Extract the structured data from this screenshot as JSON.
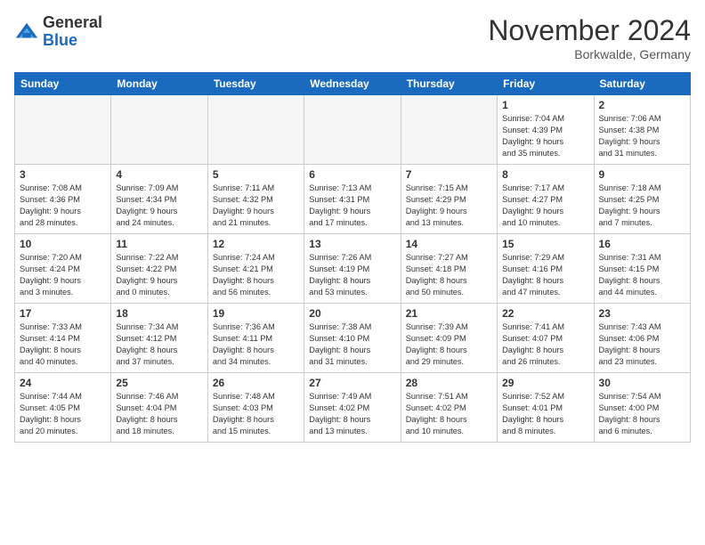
{
  "logo": {
    "general": "General",
    "blue": "Blue"
  },
  "header": {
    "title": "November 2024",
    "location": "Borkwalde, Germany"
  },
  "days_of_week": [
    "Sunday",
    "Monday",
    "Tuesday",
    "Wednesday",
    "Thursday",
    "Friday",
    "Saturday"
  ],
  "weeks": [
    [
      {
        "day": "",
        "info": ""
      },
      {
        "day": "",
        "info": ""
      },
      {
        "day": "",
        "info": ""
      },
      {
        "day": "",
        "info": ""
      },
      {
        "day": "",
        "info": ""
      },
      {
        "day": "1",
        "info": "Sunrise: 7:04 AM\nSunset: 4:39 PM\nDaylight: 9 hours\nand 35 minutes."
      },
      {
        "day": "2",
        "info": "Sunrise: 7:06 AM\nSunset: 4:38 PM\nDaylight: 9 hours\nand 31 minutes."
      }
    ],
    [
      {
        "day": "3",
        "info": "Sunrise: 7:08 AM\nSunset: 4:36 PM\nDaylight: 9 hours\nand 28 minutes."
      },
      {
        "day": "4",
        "info": "Sunrise: 7:09 AM\nSunset: 4:34 PM\nDaylight: 9 hours\nand 24 minutes."
      },
      {
        "day": "5",
        "info": "Sunrise: 7:11 AM\nSunset: 4:32 PM\nDaylight: 9 hours\nand 21 minutes."
      },
      {
        "day": "6",
        "info": "Sunrise: 7:13 AM\nSunset: 4:31 PM\nDaylight: 9 hours\nand 17 minutes."
      },
      {
        "day": "7",
        "info": "Sunrise: 7:15 AM\nSunset: 4:29 PM\nDaylight: 9 hours\nand 13 minutes."
      },
      {
        "day": "8",
        "info": "Sunrise: 7:17 AM\nSunset: 4:27 PM\nDaylight: 9 hours\nand 10 minutes."
      },
      {
        "day": "9",
        "info": "Sunrise: 7:18 AM\nSunset: 4:25 PM\nDaylight: 9 hours\nand 7 minutes."
      }
    ],
    [
      {
        "day": "10",
        "info": "Sunrise: 7:20 AM\nSunset: 4:24 PM\nDaylight: 9 hours\nand 3 minutes."
      },
      {
        "day": "11",
        "info": "Sunrise: 7:22 AM\nSunset: 4:22 PM\nDaylight: 9 hours\nand 0 minutes."
      },
      {
        "day": "12",
        "info": "Sunrise: 7:24 AM\nSunset: 4:21 PM\nDaylight: 8 hours\nand 56 minutes."
      },
      {
        "day": "13",
        "info": "Sunrise: 7:26 AM\nSunset: 4:19 PM\nDaylight: 8 hours\nand 53 minutes."
      },
      {
        "day": "14",
        "info": "Sunrise: 7:27 AM\nSunset: 4:18 PM\nDaylight: 8 hours\nand 50 minutes."
      },
      {
        "day": "15",
        "info": "Sunrise: 7:29 AM\nSunset: 4:16 PM\nDaylight: 8 hours\nand 47 minutes."
      },
      {
        "day": "16",
        "info": "Sunrise: 7:31 AM\nSunset: 4:15 PM\nDaylight: 8 hours\nand 44 minutes."
      }
    ],
    [
      {
        "day": "17",
        "info": "Sunrise: 7:33 AM\nSunset: 4:14 PM\nDaylight: 8 hours\nand 40 minutes."
      },
      {
        "day": "18",
        "info": "Sunrise: 7:34 AM\nSunset: 4:12 PM\nDaylight: 8 hours\nand 37 minutes."
      },
      {
        "day": "19",
        "info": "Sunrise: 7:36 AM\nSunset: 4:11 PM\nDaylight: 8 hours\nand 34 minutes."
      },
      {
        "day": "20",
        "info": "Sunrise: 7:38 AM\nSunset: 4:10 PM\nDaylight: 8 hours\nand 31 minutes."
      },
      {
        "day": "21",
        "info": "Sunrise: 7:39 AM\nSunset: 4:09 PM\nDaylight: 8 hours\nand 29 minutes."
      },
      {
        "day": "22",
        "info": "Sunrise: 7:41 AM\nSunset: 4:07 PM\nDaylight: 8 hours\nand 26 minutes."
      },
      {
        "day": "23",
        "info": "Sunrise: 7:43 AM\nSunset: 4:06 PM\nDaylight: 8 hours\nand 23 minutes."
      }
    ],
    [
      {
        "day": "24",
        "info": "Sunrise: 7:44 AM\nSunset: 4:05 PM\nDaylight: 8 hours\nand 20 minutes."
      },
      {
        "day": "25",
        "info": "Sunrise: 7:46 AM\nSunset: 4:04 PM\nDaylight: 8 hours\nand 18 minutes."
      },
      {
        "day": "26",
        "info": "Sunrise: 7:48 AM\nSunset: 4:03 PM\nDaylight: 8 hours\nand 15 minutes."
      },
      {
        "day": "27",
        "info": "Sunrise: 7:49 AM\nSunset: 4:02 PM\nDaylight: 8 hours\nand 13 minutes."
      },
      {
        "day": "28",
        "info": "Sunrise: 7:51 AM\nSunset: 4:02 PM\nDaylight: 8 hours\nand 10 minutes."
      },
      {
        "day": "29",
        "info": "Sunrise: 7:52 AM\nSunset: 4:01 PM\nDaylight: 8 hours\nand 8 minutes."
      },
      {
        "day": "30",
        "info": "Sunrise: 7:54 AM\nSunset: 4:00 PM\nDaylight: 8 hours\nand 6 minutes."
      }
    ]
  ]
}
